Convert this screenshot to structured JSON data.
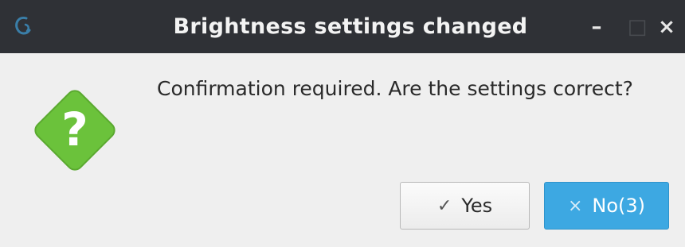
{
  "window": {
    "title": "Brightness settings changed",
    "controls": {
      "minimize": "–",
      "maximize": "□",
      "close": "×"
    }
  },
  "dialog": {
    "message": "Confirmation required. Are the settings correct?",
    "icon": "question-icon",
    "buttons": {
      "yes": {
        "glyph": "✓",
        "label": "Yes"
      },
      "no": {
        "glyph": "×",
        "label": "No(3)"
      }
    }
  },
  "colors": {
    "titlebar": "#2f3136",
    "background": "#efefef",
    "icon_green": "#6bc23b",
    "primary_button": "#3da8e2"
  }
}
